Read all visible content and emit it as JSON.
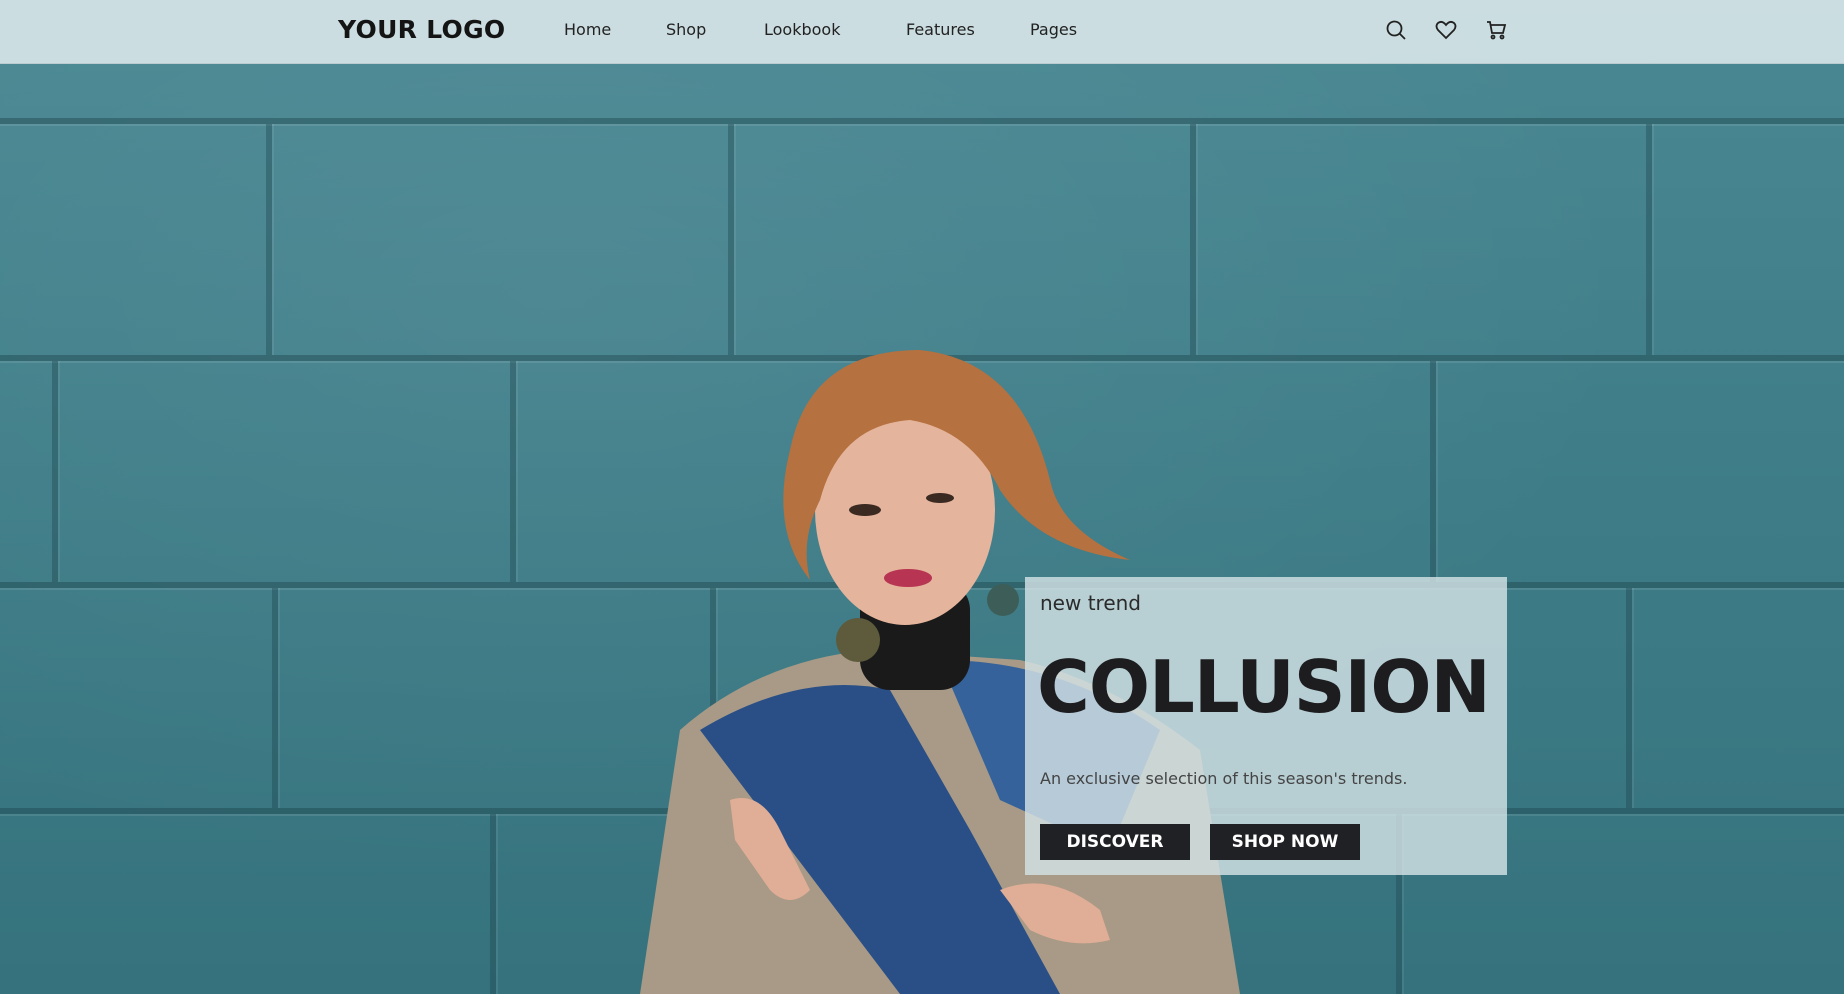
{
  "header": {
    "logo": "YOUR LOGO",
    "nav": [
      {
        "label": "Home"
      },
      {
        "label": "Shop"
      },
      {
        "label": "Lookbook"
      },
      {
        "label": "Features"
      },
      {
        "label": "Pages"
      }
    ],
    "icons": [
      "search-icon",
      "heart-icon",
      "cart-icon"
    ]
  },
  "hero": {
    "kicker": "new trend",
    "title": "COLLUSION",
    "description": "An exclusive selection of this season's trends.",
    "buttons": {
      "discover": "DISCOVER",
      "shop_now": "SHOP NOW"
    }
  },
  "colors": {
    "wall": "#3f7d89",
    "header_bg": "#d6e4e7",
    "button_bg": "#202124",
    "button_text": "#ffffff",
    "title": "#1d1d1f"
  }
}
